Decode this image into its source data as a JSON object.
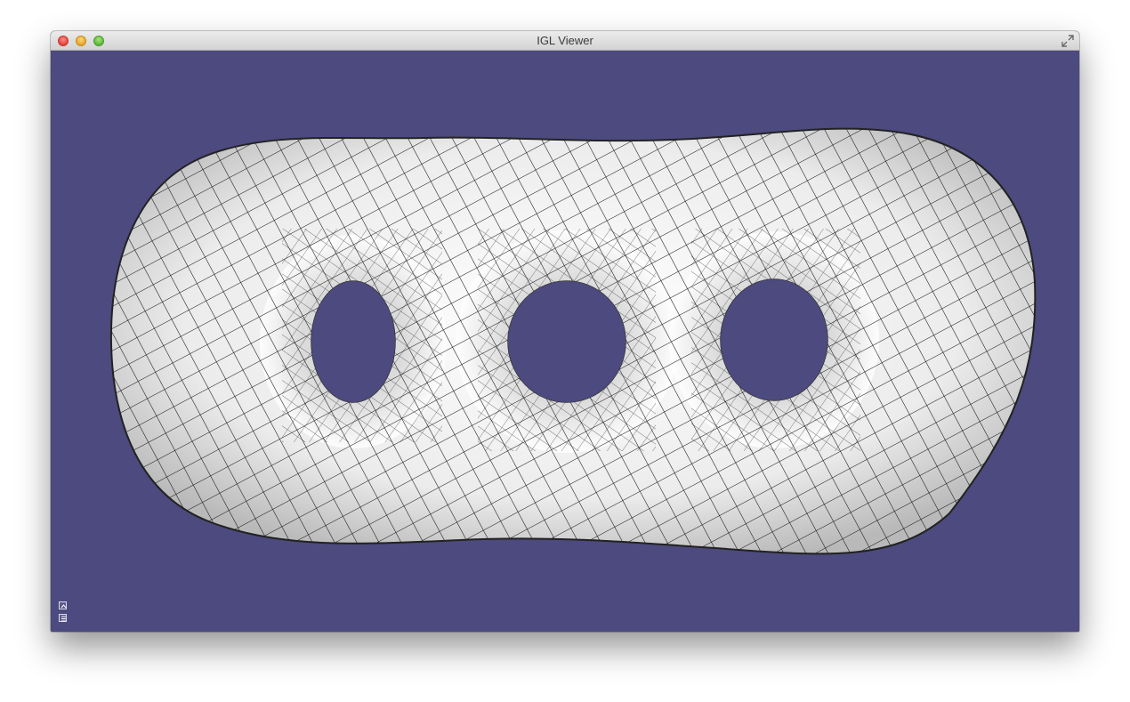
{
  "window": {
    "title": "IGL Viewer"
  },
  "colors": {
    "background": "#4c4a7e",
    "mesh_fill": "#f2f2f2",
    "mesh_lines": "#111111"
  },
  "icons": {
    "close": "close-icon",
    "minimize": "minimize-icon",
    "zoom": "zoom-icon",
    "fullscreen": "fullscreen-icon",
    "viewer_toggle_1": "expand-panel-icon",
    "viewer_toggle_2": "settings-panel-icon"
  }
}
